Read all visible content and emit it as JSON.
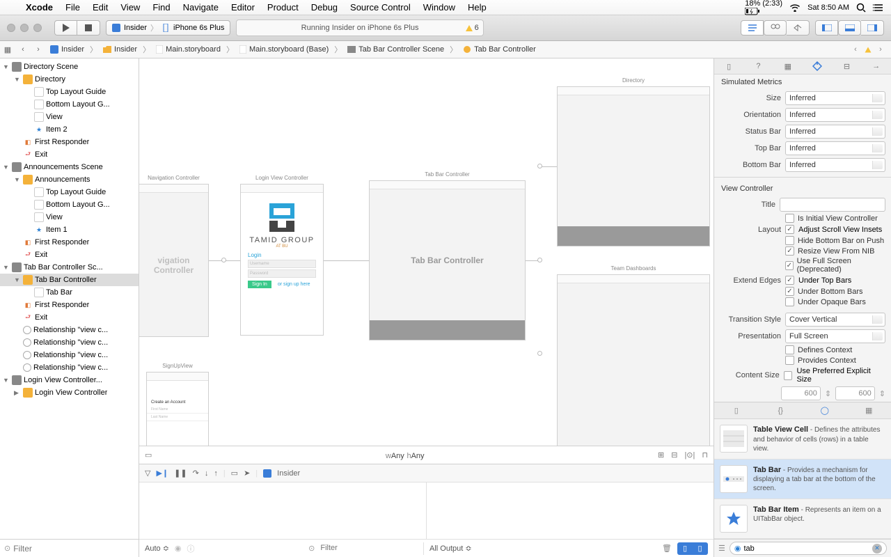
{
  "menubar": {
    "app": "Xcode",
    "items": [
      "File",
      "Edit",
      "View",
      "Find",
      "Navigate",
      "Editor",
      "Product",
      "Debug",
      "Source Control",
      "Window",
      "Help"
    ],
    "battery": "18% (2:33)",
    "clock": "Sat 8:50 AM"
  },
  "toolbar": {
    "scheme_target": "Insider",
    "scheme_device": "iPhone 6s Plus",
    "status": "Running Insider on iPhone 6s Plus",
    "warnings": "6"
  },
  "jumpbar": {
    "segments": [
      "Insider",
      "Insider",
      "Main.storyboard",
      "Main.storyboard (Base)",
      "Tab Bar Controller Scene",
      "Tab Bar Controller"
    ]
  },
  "navigator": {
    "filter_placeholder": "Filter",
    "tree": [
      {
        "d": 0,
        "type": "scene",
        "label": "Directory Scene",
        "disclosure": "▼"
      },
      {
        "d": 1,
        "type": "folder",
        "label": "Directory",
        "disclosure": "▼"
      },
      {
        "d": 2,
        "type": "doc",
        "label": "Top Layout Guide"
      },
      {
        "d": 2,
        "type": "doc",
        "label": "Bottom Layout G..."
      },
      {
        "d": 2,
        "type": "doc",
        "label": "View"
      },
      {
        "d": 2,
        "type": "star",
        "label": "Item 2"
      },
      {
        "d": 1,
        "type": "cube",
        "label": "First Responder"
      },
      {
        "d": 1,
        "type": "exit",
        "label": "Exit"
      },
      {
        "d": 0,
        "type": "scene",
        "label": "Announcements Scene",
        "disclosure": "▼"
      },
      {
        "d": 1,
        "type": "folder",
        "label": "Announcements",
        "disclosure": "▼"
      },
      {
        "d": 2,
        "type": "doc",
        "label": "Top Layout Guide"
      },
      {
        "d": 2,
        "type": "doc",
        "label": "Bottom Layout G..."
      },
      {
        "d": 2,
        "type": "doc",
        "label": "View"
      },
      {
        "d": 2,
        "type": "star",
        "label": "Item 1"
      },
      {
        "d": 1,
        "type": "cube",
        "label": "First Responder"
      },
      {
        "d": 1,
        "type": "exit",
        "label": "Exit"
      },
      {
        "d": 0,
        "type": "scene",
        "label": "Tab Bar Controller Sc...",
        "disclosure": "▼"
      },
      {
        "d": 1,
        "type": "folder",
        "label": "Tab Bar Controller",
        "disclosure": "▼",
        "sel": true
      },
      {
        "d": 2,
        "type": "doc",
        "label": "Tab Bar"
      },
      {
        "d": 1,
        "type": "cube",
        "label": "First Responder"
      },
      {
        "d": 1,
        "type": "exit",
        "label": "Exit"
      },
      {
        "d": 1,
        "type": "circle",
        "label": "Relationship \"view c..."
      },
      {
        "d": 1,
        "type": "circle",
        "label": "Relationship \"view c..."
      },
      {
        "d": 1,
        "type": "circle",
        "label": "Relationship \"view c..."
      },
      {
        "d": 1,
        "type": "circle",
        "label": "Relationship \"view c..."
      },
      {
        "d": 0,
        "type": "scene",
        "label": "Login View Controller...",
        "disclosure": "▼"
      },
      {
        "d": 1,
        "type": "folder",
        "label": "Login View Controller",
        "disclosure": "▶"
      }
    ]
  },
  "canvas": {
    "scenes": {
      "nav": {
        "title": "Navigation Controller",
        "label": "vigation Controller"
      },
      "login": {
        "title": "Login View Controller",
        "brand": "TAMID GROUP",
        "brand_sub": "AT BU",
        "section": "Login",
        "user_ph": "Username",
        "pass_ph": "Password",
        "signin": "Sign In",
        "signup": "or sign up here"
      },
      "signup": {
        "title": "SignUpView",
        "heading": "Create an Account",
        "first": "First Name",
        "last": "Last Name"
      },
      "tabbar": {
        "title": "Tab Bar Controller",
        "label": "Tab Bar Controller"
      },
      "directory": {
        "title": "Directory"
      },
      "dashboards": {
        "title": "Team Dashboards"
      }
    },
    "size_label_w": "w",
    "size_label_h": "h",
    "size_any": "Any"
  },
  "debug": {
    "process_label": "Insider",
    "auto_label": "Auto",
    "filter_placeholder": "Filter",
    "output_label": "All Output"
  },
  "inspector": {
    "section_sim": "Simulated Metrics",
    "size_label": "Size",
    "size_val": "Inferred",
    "orient_label": "Orientation",
    "orient_val": "Inferred",
    "status_label": "Status Bar",
    "status_val": "Inferred",
    "top_label": "Top Bar",
    "top_val": "Inferred",
    "bottom_label": "Bottom Bar",
    "bottom_val": "Inferred",
    "section_vc": "View Controller",
    "title_label": "Title",
    "title_val": "",
    "initial_label": "Is Initial View Controller",
    "layout_label": "Layout",
    "adjust_label": "Adjust Scroll View Insets",
    "hide_label": "Hide Bottom Bar on Push",
    "resize_label": "Resize View From NIB",
    "fullscreen_label": "Use Full Screen (Deprecated)",
    "extend_label": "Extend Edges",
    "under_top_label": "Under Top Bars",
    "under_bottom_label": "Under Bottom Bars",
    "under_opaque_label": "Under Opaque Bars",
    "transition_label": "Transition Style",
    "transition_val": "Cover Vertical",
    "presentation_label": "Presentation",
    "presentation_val": "Full Screen",
    "defines_label": "Defines Context",
    "provides_label": "Provides Context",
    "content_label": "Content Size",
    "use_pref_label": "Use Preferred Explicit Size",
    "content_w": "600",
    "content_h": "600"
  },
  "library": {
    "items": [
      {
        "title": "Table View Cell",
        "desc": " - Defines the attributes and behavior of cells (rows) in a table view."
      },
      {
        "title": "Tab Bar",
        "desc": " - Provides a mechanism for displaying a tab bar at the bottom of the screen.",
        "sel": true
      },
      {
        "title": "Tab Bar Item",
        "desc": " - Represents an item on a UITabBar object."
      }
    ],
    "filter_value": "tab"
  }
}
